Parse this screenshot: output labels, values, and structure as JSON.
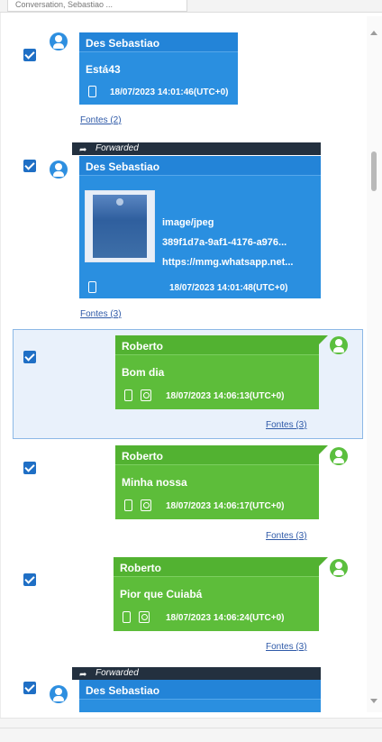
{
  "window": {
    "tab_label": "Conversation, Sebastiao ..."
  },
  "messages": [
    {
      "sender": "Des Sebastiao",
      "text": "Está43",
      "timestamp": "18/07/2023 14:01:46(UTC+0)",
      "fontes": "Fontes (2)",
      "color": "#2a8fe0"
    },
    {
      "forwarded_label": "Forwarded",
      "sender": "Des Sebastiao",
      "attachment": {
        "type": "image/jpeg",
        "name": "389f1d7a-9af1-4176-a976...",
        "url": "https://mmg.whatsapp.net..."
      },
      "timestamp": "18/07/2023 14:01:48(UTC+0)",
      "fontes": "Fontes (3)",
      "color": "#2a8fe0"
    },
    {
      "sender": "Roberto",
      "text": "Bom dia",
      "timestamp": "18/07/2023 14:06:13(UTC+0)",
      "fontes": "Fontes (3)",
      "color": "#5dbd3a",
      "selected": true
    },
    {
      "sender": "Roberto",
      "text": "Minha nossa",
      "timestamp": "18/07/2023 14:06:17(UTC+0)",
      "fontes": "Fontes (3)",
      "color": "#5dbd3a"
    },
    {
      "sender": "Roberto",
      "text": "Pior que Cuiabá",
      "timestamp": "18/07/2023 14:06:24(UTC+0)",
      "fontes": "Fontes (3)",
      "color": "#5dbd3a"
    },
    {
      "forwarded_label": "Forwarded",
      "sender": "Des Sebastiao",
      "color": "#2a8fe0"
    }
  ],
  "icons": {
    "checkbox": "checkbox-checked-icon",
    "avatar": "user-avatar-icon",
    "device": "phone-icon",
    "contact": "contact-card-icon",
    "forward": "forward-arrow-icon"
  },
  "colors": {
    "blue_bubble": "#2a8fe0",
    "green_bubble": "#5dbd3a",
    "forward_banner": "#23303f",
    "selection": "#e9f1fb"
  }
}
